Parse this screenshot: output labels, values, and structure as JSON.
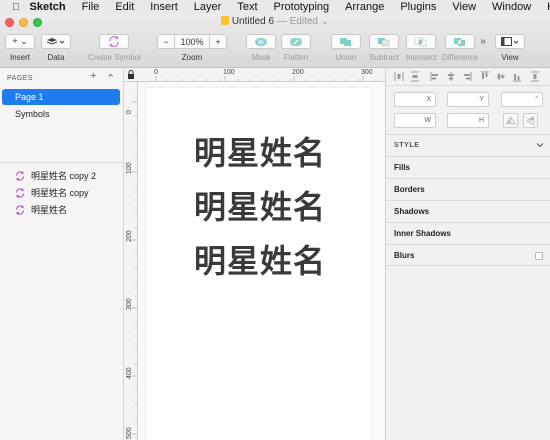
{
  "menubar": {
    "app": "Sketch",
    "items": [
      "File",
      "Edit",
      "Insert",
      "Layer",
      "Text",
      "Prototyping",
      "Arrange",
      "Plugins",
      "View",
      "Window",
      "Help"
    ]
  },
  "window": {
    "title": "Untitled 6",
    "status": "— Edited",
    "status_arrow": "⌄"
  },
  "toolbar": {
    "insert_label": "Insert",
    "insert_glyph": "+ ⌄",
    "data_label": "Data",
    "create_symbol_label": "Create Symbol",
    "zoom_minus": "−",
    "zoom_value": "100%",
    "zoom_plus": "+",
    "zoom_label": "Zoom",
    "mask_label": "Mask",
    "flatten_label": "Flatten",
    "union_label": "Union",
    "subtract_label": "Subtract",
    "intersect_label": "Intersect",
    "difference_label": "Difference",
    "overflow_glyph": "»",
    "view_label": "View"
  },
  "sidebar": {
    "pages_title": "PAGES",
    "add_glyph": "+",
    "collapse_glyph": "⌃",
    "pages": [
      {
        "label": "Page 1",
        "selected": true
      },
      {
        "label": "Symbols",
        "selected": false
      }
    ],
    "layers": [
      {
        "label": "明星姓名 copy 2"
      },
      {
        "label": "明星姓名 copy"
      },
      {
        "label": "明星姓名"
      }
    ]
  },
  "rulers": {
    "top": [
      "0",
      "100",
      "200",
      "300"
    ],
    "left": [
      "0",
      "100",
      "200",
      "300",
      "400",
      "500"
    ]
  },
  "canvas": {
    "texts": [
      "明星姓名",
      "明星姓名",
      "明星姓名"
    ]
  },
  "inspector": {
    "x_label": "X",
    "y_label": "Y",
    "w_label": "W",
    "h_label": "H",
    "rotate_label": "°",
    "style_title": "STYLE",
    "sections": [
      "Fills",
      "Borders",
      "Shadows",
      "Inner Shadows",
      "Blurs"
    ]
  },
  "colors": {
    "selection_blue": "#1e7cf0",
    "symbol_purple": "#b14fd0",
    "boolean_teal": "#7fd1c7"
  }
}
